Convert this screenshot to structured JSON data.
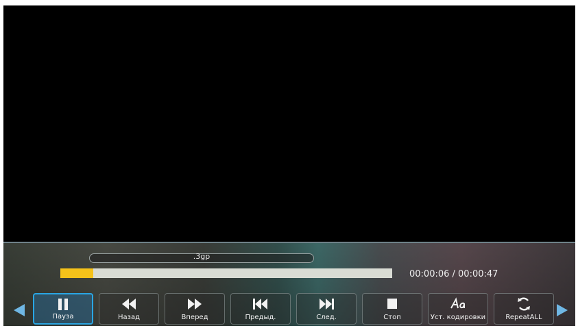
{
  "player": {
    "filename": ".3gp",
    "time": "00:00:06 / 00:00:47",
    "progress_fraction": 0.1
  },
  "controls": [
    {
      "label": "Пауза",
      "icon": "pause-icon",
      "active": true
    },
    {
      "label": "Назад",
      "icon": "rewind-icon",
      "active": false
    },
    {
      "label": "Вперед",
      "icon": "fast-forward-icon",
      "active": false
    },
    {
      "label": "Предыд.",
      "icon": "previous-track-icon",
      "active": false
    },
    {
      "label": "След.",
      "icon": "next-track-icon",
      "active": false
    },
    {
      "label": "Стоп",
      "icon": "stop-icon",
      "active": false
    },
    {
      "label": "Уст. кодировки",
      "icon": "encoding-aa-icon",
      "active": false
    },
    {
      "label": "RepeatALL",
      "icon": "repeat-icon",
      "active": false
    }
  ],
  "colors": {
    "progress_fill": "#f5c21a",
    "progress_track": "#d9dcd4",
    "highlight": "#2aa6e3",
    "nav_arrow": "#6fb7e4"
  }
}
